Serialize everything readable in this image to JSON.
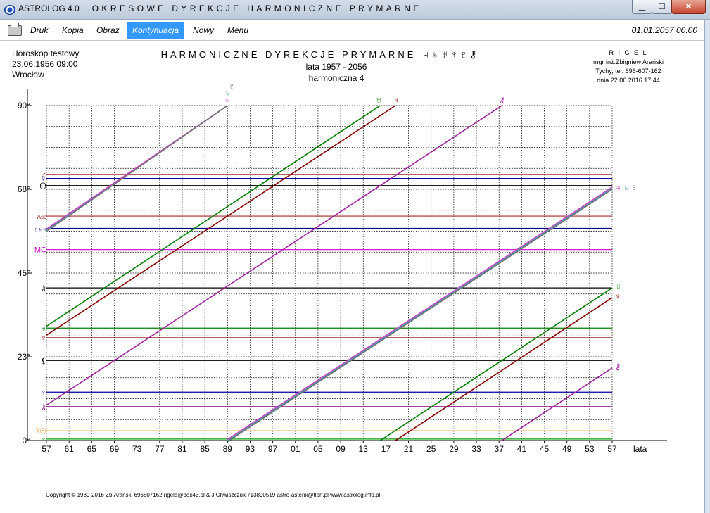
{
  "window": {
    "app_name": "ASTROLOG 4.0",
    "title": "OKRESOWE DYREKCJE HARMONICZNE PRYMARNE",
    "min_glyph": "▁",
    "max_glyph": "☐",
    "close_glyph": "✕"
  },
  "menu": {
    "items": [
      "Druk",
      "Kopia",
      "Obraz",
      "Kontynuacja",
      "Nowy",
      "Menu"
    ],
    "active_index": 3,
    "datetime": "01.01.2057  00:00"
  },
  "header": {
    "left": [
      "Horoskop testowy",
      "23.06.1956  09:00",
      "Wrocław"
    ],
    "title": "HARMONICZNE DYREKCJE PRYMARNE",
    "title_symbols": "♃♄♅♆♇⚷",
    "subtitle": "lata  1957  -  2056",
    "harmonic": "harmoniczna 4",
    "right": [
      "R I G E L",
      "mgr inż.Zbigniew Arański",
      "Tychy, tel. 696-607-162",
      "dnia 22.06.2016  17:44"
    ]
  },
  "footer": {
    "copyright": "Copyright © 1989-2016 Zb.Arański 696607162 rigela@box43.pl & J.Chwiszczuk 713890519 astro-asterix@tlen.pl www.astrolog.info.pl"
  },
  "chart_data": {
    "type": "line",
    "x_unit_label": "lata",
    "x_tick_labels": [
      "57",
      "61",
      "65",
      "69",
      "73",
      "77",
      "81",
      "85",
      "89",
      "93",
      "97",
      "01",
      "05",
      "09",
      "13",
      "17",
      "21",
      "25",
      "29",
      "33",
      "37",
      "41",
      "45",
      "49",
      "53",
      "57"
    ],
    "x_range": [
      1957,
      2057
    ],
    "y_range": [
      0,
      90
    ],
    "y_ticks": [
      {
        "value": 0,
        "label": "0°"
      },
      {
        "value": 22.5,
        "label": "23°"
      },
      {
        "value": 45,
        "label": "45°"
      },
      {
        "value": 67.5,
        "label": "68°"
      },
      {
        "value": 90,
        "label": "90°"
      }
    ],
    "grid": true,
    "horizontal_lines": [
      {
        "glyph": "♂",
        "value": 71.5,
        "color": "#a52a2a"
      },
      {
        "glyph": "☿",
        "value": 70.4,
        "color": "#0000a0"
      },
      {
        "glyph": "☊",
        "value": 68.5,
        "color": "#000000"
      },
      {
        "glyph": "Asc",
        "value": 60.3,
        "color": "#a52a2a"
      },
      {
        "glyph": "♇♄♃",
        "value": 57.0,
        "color": "#000080"
      },
      {
        "glyph": "MC",
        "value": 51.3,
        "color": "#cc00cc"
      },
      {
        "glyph": "⚷",
        "value": 41.0,
        "color": "#000000"
      },
      {
        "glyph": "♅",
        "value": 30.2,
        "color": "#008000"
      },
      {
        "glyph": "♆",
        "value": 27.6,
        "color": "#8b0000"
      },
      {
        "glyph": "⚸",
        "value": 21.5,
        "color": "#000000"
      },
      {
        "glyph": "♀",
        "value": 13.0,
        "color": "#0000a0"
      },
      {
        "glyph": "⚷",
        "value": 9.1,
        "color": "#8b008b"
      },
      {
        "glyph": "☽☉",
        "value": 2.6,
        "color": "#ff8c00"
      },
      {
        "glyph": "♆",
        "value": 0.4,
        "color": "#00a000"
      }
    ],
    "series": [
      {
        "name": "♄",
        "color": "#3aa8a8",
        "points": [
          [
            1957,
            56.5
          ],
          [
            1989,
            90.0
          ]
        ]
      },
      {
        "name": "♃",
        "color": "#cc44cc",
        "points": [
          [
            1957,
            56.8
          ],
          [
            1989,
            90.0
          ]
        ]
      },
      {
        "name": "♇",
        "color": "#707070",
        "points": [
          [
            1957,
            56.2
          ],
          [
            1989,
            90.0
          ]
        ]
      },
      {
        "name": "♄",
        "color": "#3aa8a8",
        "points": [
          [
            1989,
            0.0
          ],
          [
            2057,
            67.8
          ]
        ]
      },
      {
        "name": "♃",
        "color": "#cc44cc",
        "points": [
          [
            1989,
            0.3
          ],
          [
            2057,
            68.1
          ]
        ]
      },
      {
        "name": "♇",
        "color": "#707070",
        "points": [
          [
            1989,
            -0.3
          ],
          [
            2057,
            67.5
          ]
        ]
      },
      {
        "name": "♅",
        "color": "#008000",
        "points": [
          [
            1957,
            30.7
          ],
          [
            2016,
            90.0
          ]
        ]
      },
      {
        "name": "♅",
        "color": "#008000",
        "points": [
          [
            2016,
            0.0
          ],
          [
            2057,
            41.0
          ]
        ]
      },
      {
        "name": "♆",
        "color": "#8b0000",
        "points": [
          [
            1957,
            28.3
          ],
          [
            2018.7,
            90.0
          ]
        ]
      },
      {
        "name": "♆",
        "color": "#8b0000",
        "points": [
          [
            2018.7,
            0.0
          ],
          [
            2057,
            38.4
          ]
        ]
      },
      {
        "name": "⚷",
        "color": "#a020a0",
        "points": [
          [
            1957,
            9.5
          ],
          [
            2037.5,
            90.0
          ]
        ]
      },
      {
        "name": "⚷",
        "color": "#a020a0",
        "points": [
          [
            2037.5,
            0.0
          ],
          [
            2057,
            19.5
          ]
        ]
      }
    ],
    "end_labels": [
      {
        "text": "♄",
        "x": 1989,
        "y": 90,
        "color": "#3aa8a8",
        "dx": 0,
        "dy": -14
      },
      {
        "text": "♇",
        "x": 1989,
        "y": 90,
        "color": "#555555",
        "dx": 6,
        "dy": -24
      },
      {
        "text": "♃",
        "x": 1989,
        "y": 90,
        "color": "#cc44cc",
        "dx": 0,
        "dy": -3
      },
      {
        "text": "♅",
        "x": 2016,
        "y": 90,
        "color": "#008000",
        "dx": -2,
        "dy": -4
      },
      {
        "text": "♆",
        "x": 2018.7,
        "y": 90,
        "color": "#8b0000",
        "dx": 2,
        "dy": -4
      },
      {
        "text": "⚷",
        "x": 2037.5,
        "y": 90,
        "color": "#a020a0",
        "dx": 0,
        "dy": -4
      },
      {
        "text": "♃",
        "x": 2057,
        "y": 67.8,
        "color": "#cc44cc",
        "dx": 8,
        "dy": 3
      },
      {
        "text": "♄",
        "x": 2057,
        "y": 67.8,
        "color": "#3aa8a8",
        "dx": 20,
        "dy": 3
      },
      {
        "text": "♇",
        "x": 2057,
        "y": 67.8,
        "color": "#555555",
        "dx": 31,
        "dy": 3
      },
      {
        "text": "♅",
        "x": 2057,
        "y": 41.0,
        "color": "#008000",
        "dx": 8,
        "dy": 2
      },
      {
        "text": "♆",
        "x": 2057,
        "y": 38.4,
        "color": "#8b0000",
        "dx": 8,
        "dy": 2
      },
      {
        "text": "⚷",
        "x": 2057,
        "y": 19.5,
        "color": "#a020a0",
        "dx": 8,
        "dy": 2
      }
    ]
  }
}
